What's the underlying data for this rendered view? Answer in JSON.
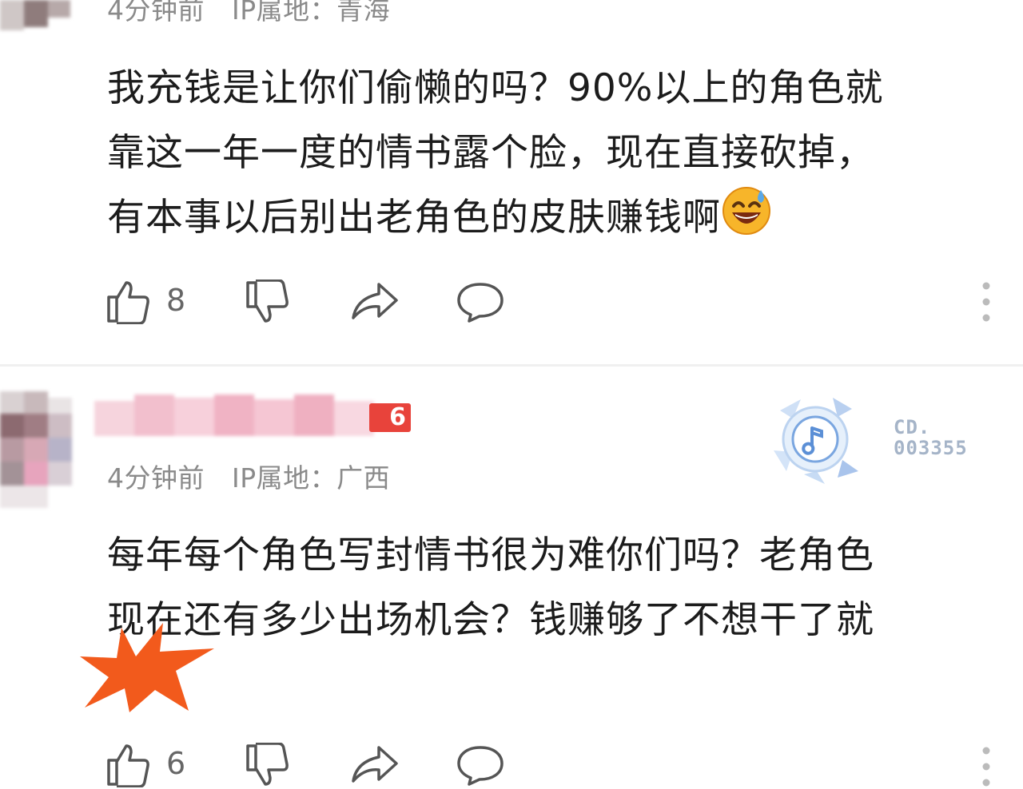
{
  "comments": [
    {
      "time": "4分钟前",
      "ip": "IP属地：青海",
      "lines": [
        "我充钱是让你们偷懒的吗？90%以上的角色就",
        "靠这一年一度的情书露个脸，现在直接砍掉，",
        "有本事以后别出老角色的皮肤赚钱啊"
      ],
      "emoji": "grinning-sweat-emoji",
      "likes": "8"
    },
    {
      "time": "4分钟前",
      "ip": "IP属地：广西",
      "level_badge": "6",
      "badge_code_line1": "CD.",
      "badge_code_line2": "003355",
      "lines": [
        "每年每个角色写封情书很为难你们吗？老角色",
        "现在还有多少出场机会？钱赚够了不想干了就"
      ],
      "likes": "6"
    }
  ],
  "colors": {
    "accent_orange": "#f25a1c",
    "text_meta": "#8a8a8a",
    "badge_blue": "#5b8fd6"
  },
  "icons": {
    "like": "thumbs-up-icon",
    "dislike": "thumbs-down-icon",
    "share": "share-arrow-icon",
    "reply": "chat-bubble-icon",
    "more": "more-vertical-icon"
  }
}
